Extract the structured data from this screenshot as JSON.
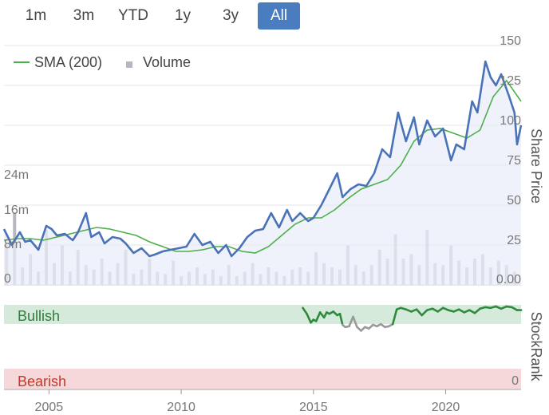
{
  "range_selector": {
    "buttons": [
      "1m",
      "3m",
      "YTD",
      "1y",
      "3y",
      "All"
    ],
    "active": "All"
  },
  "chart_data": {
    "type": "line",
    "legend": [
      "SMA (200)",
      "Volume"
    ],
    "price_axis": {
      "title": "Share Price",
      "ticks": [
        "150",
        "125",
        "100",
        "75",
        "50",
        "25",
        "0.00"
      ],
      "ylim": [
        0,
        150
      ]
    },
    "volume_axis": {
      "ticks": [
        "24m",
        "16m",
        "8m",
        "0"
      ],
      "ylim": [
        0,
        30000000
      ]
    },
    "x_ticks": [
      "2005",
      "2010",
      "2015",
      "2020"
    ],
    "xlim": [
      2003.3,
      2022.85
    ],
    "series": [
      {
        "name": "Share Price",
        "color": "#4a72b8",
        "x": [
          2003.3,
          2003.6,
          2003.9,
          2004.1,
          2004.3,
          2004.6,
          2004.9,
          2005.1,
          2005.3,
          2005.6,
          2005.9,
          2006.1,
          2006.4,
          2006.6,
          2006.9,
          2007.1,
          2007.4,
          2007.7,
          2007.9,
          2008.2,
          2008.5,
          2008.8,
          2009.0,
          2009.3,
          2009.6,
          2009.9,
          2010.2,
          2010.5,
          2010.8,
          2011.1,
          2011.4,
          2011.7,
          2011.9,
          2012.2,
          2012.5,
          2012.8,
          2013.1,
          2013.4,
          2013.7,
          2014.0,
          2014.2,
          2014.5,
          2014.8,
          2015.0,
          2015.3,
          2015.6,
          2015.9,
          2016.1,
          2016.4,
          2016.7,
          2017.0,
          2017.3,
          2017.6,
          2017.9,
          2018.2,
          2018.5,
          2018.8,
          2019.0,
          2019.3,
          2019.6,
          2019.9,
          2020.2,
          2020.4,
          2020.7,
          2021.0,
          2021.2,
          2021.5,
          2021.7,
          2021.9,
          2022.1,
          2022.4,
          2022.6,
          2022.7,
          2022.85
        ],
        "values": [
          35,
          25,
          33,
          27,
          28,
          22,
          37,
          35,
          31,
          32,
          28,
          33,
          45,
          30,
          33,
          26,
          30,
          29,
          26,
          20,
          23,
          18,
          19,
          21,
          22,
          23,
          24,
          32,
          25,
          27,
          20,
          25,
          18,
          23,
          30,
          34,
          35,
          45,
          36,
          47,
          40,
          45,
          40,
          42,
          50,
          60,
          70,
          55,
          60,
          63,
          62,
          70,
          85,
          80,
          108,
          90,
          105,
          88,
          103,
          93,
          98,
          78,
          88,
          85,
          115,
          108,
          140,
          130,
          125,
          132,
          118,
          108,
          88,
          100
        ]
      },
      {
        "name": "SMA (200)",
        "color": "#4daf4a",
        "x": [
          2003.3,
          2003.8,
          2004.3,
          2004.8,
          2005.3,
          2005.8,
          2006.3,
          2006.8,
          2007.3,
          2007.8,
          2008.3,
          2008.8,
          2009.3,
          2009.8,
          2010.3,
          2010.8,
          2011.3,
          2011.8,
          2012.3,
          2012.8,
          2013.3,
          2013.8,
          2014.3,
          2014.8,
          2015.3,
          2015.8,
          2016.3,
          2016.8,
          2017.3,
          2017.8,
          2018.3,
          2018.8,
          2019.3,
          2019.8,
          2020.3,
          2020.8,
          2021.3,
          2021.8,
          2022.3,
          2022.85
        ],
        "values": [
          28,
          29,
          29,
          28,
          30,
          32,
          34,
          36,
          35,
          33,
          31,
          27,
          24,
          21,
          21,
          22,
          24,
          24,
          21,
          20,
          24,
          31,
          38,
          42,
          42,
          47,
          54,
          60,
          63,
          66,
          75,
          90,
          97,
          98,
          95,
          92,
          97,
          118,
          128,
          115
        ]
      }
    ],
    "volume": {
      "color": "#b7b7bf",
      "x": [
        2003.4,
        2003.7,
        2004.0,
        2004.3,
        2004.6,
        2004.9,
        2005.2,
        2005.5,
        2005.8,
        2006.1,
        2006.4,
        2006.7,
        2007.0,
        2007.3,
        2007.6,
        2007.9,
        2008.2,
        2008.5,
        2008.8,
        2009.1,
        2009.4,
        2009.7,
        2010.0,
        2010.3,
        2010.6,
        2010.9,
        2011.2,
        2011.5,
        2011.8,
        2012.1,
        2012.4,
        2012.7,
        2013.0,
        2013.3,
        2013.6,
        2013.9,
        2014.2,
        2014.5,
        2014.8,
        2015.1,
        2015.4,
        2015.7,
        2016.0,
        2016.3,
        2016.6,
        2016.9,
        2017.2,
        2017.5,
        2017.8,
        2018.1,
        2018.4,
        2018.7,
        2019.0,
        2019.3,
        2019.6,
        2019.9,
        2020.2,
        2020.5,
        2020.8,
        2021.1,
        2021.4,
        2021.7,
        2022.0,
        2022.3,
        2022.6
      ],
      "values": [
        9000000,
        16500000,
        4000000,
        7000000,
        3000000,
        12500000,
        5000000,
        9000000,
        3000000,
        8000000,
        4500000,
        3500000,
        6000000,
        3000000,
        5000000,
        8000000,
        2500000,
        3500000,
        6000000,
        3000000,
        2500000,
        5500000,
        2000000,
        3000000,
        4000000,
        2500000,
        3500000,
        2000000,
        4500000,
        2000000,
        3000000,
        5000000,
        2500000,
        4000000,
        3000000,
        2000000,
        3500000,
        4000000,
        3000000,
        7500000,
        5000000,
        4000000,
        3500000,
        9000000,
        4500000,
        3000000,
        4500000,
        8000000,
        6000000,
        11500000,
        6000000,
        7000000,
        4500000,
        12500000,
        5000000,
        4500000,
        9000000,
        5500000,
        4000000,
        6000000,
        7000000,
        4000000,
        5500000,
        4500000,
        3000000
      ]
    }
  },
  "stockrank": {
    "title": "StockRank",
    "bullish_label": "Bullish",
    "bearish_label": "Bearish",
    "zero_label": "0",
    "x": [
      2014.6,
      2014.75,
      2014.9,
      2015.0,
      2015.1,
      2015.25,
      2015.4,
      2015.5,
      2015.6,
      2015.75,
      2015.9,
      2016.0,
      2016.1,
      2016.2,
      2016.35,
      2016.5,
      2016.65,
      2016.8,
      2016.95,
      2017.1,
      2017.25,
      2017.4,
      2017.55,
      2017.7,
      2017.85,
      2018.0,
      2018.15,
      2018.3,
      2018.5,
      2018.7,
      2018.9,
      2019.1,
      2019.3,
      2019.5,
      2019.7,
      2019.9,
      2020.1,
      2020.3,
      2020.5,
      2020.7,
      2020.9,
      2021.1,
      2021.3,
      2021.5,
      2021.7,
      2021.9,
      2022.1,
      2022.3,
      2022.5,
      2022.7,
      2022.85
    ],
    "values": [
      98,
      90,
      78,
      82,
      80,
      92,
      85,
      92,
      90,
      93,
      88,
      90,
      75,
      72,
      73,
      86,
      72,
      67,
      72,
      70,
      75,
      73,
      76,
      72,
      73,
      76,
      96,
      98,
      96,
      93,
      96,
      88,
      95,
      97,
      93,
      98,
      95,
      93,
      96,
      92,
      95,
      91,
      97,
      99,
      98,
      100,
      97,
      100,
      99,
      95,
      95
    ],
    "green_threshold": 80,
    "green_color": "#2e8b3d",
    "grey_color": "#9a9a9a"
  }
}
